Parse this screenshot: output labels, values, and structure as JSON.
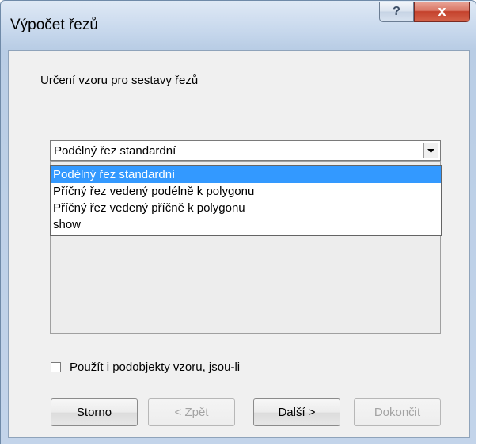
{
  "window": {
    "title": "Výpočet řezů",
    "help_symbol": "?",
    "close_symbol": "x"
  },
  "dialog": {
    "prompt": "Určení vzoru pro sestavy řezů",
    "combo_value": "Podélný řez standardní",
    "options": [
      "Podélný řez standardní",
      "Příčný řez vedený podélně k polygonu",
      "Příčný řez vedený příčně k polygonu",
      "show"
    ],
    "selected_option_index": 0,
    "checkbox_label": "Použít i podobjekty vzoru, jsou-li",
    "checkbox_checked": false
  },
  "buttons": {
    "cancel": "Storno",
    "back": "< Zpět",
    "next": "Další >",
    "finish": "Dokončit"
  },
  "icons": {
    "combo_arrow": "chevron-down-icon",
    "help": "help-icon",
    "close": "close-icon"
  },
  "colors": {
    "selection": "#3399ff",
    "close_button": "#c4412c"
  }
}
